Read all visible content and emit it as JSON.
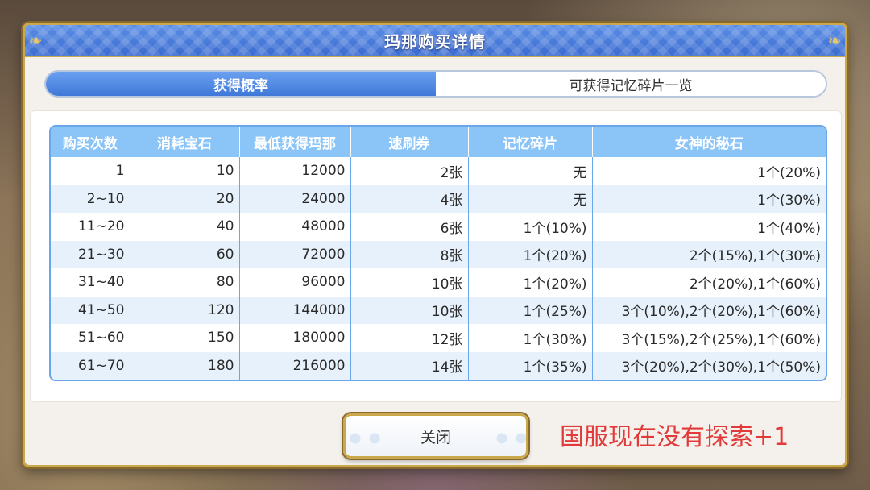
{
  "dialog": {
    "title": "玛那购买详情",
    "tabs": [
      {
        "label": "获得概率",
        "active": true
      },
      {
        "label": "可获得记忆碎片一览",
        "active": false
      }
    ]
  },
  "table": {
    "headers": [
      "购买次数",
      "消耗宝石",
      "最低获得玛那",
      "速刷券",
      "记忆碎片",
      "女神的秘石"
    ],
    "rows": [
      [
        "1",
        "10",
        "12000",
        "2张",
        "无",
        "1个(20%)"
      ],
      [
        "2~10",
        "20",
        "24000",
        "4张",
        "无",
        "1个(30%)"
      ],
      [
        "11~20",
        "40",
        "48000",
        "6张",
        "1个(10%)",
        "1个(40%)"
      ],
      [
        "21~30",
        "60",
        "72000",
        "8张",
        "1个(20%)",
        "2个(15%),1个(30%)"
      ],
      [
        "31~40",
        "80",
        "96000",
        "10张",
        "1个(20%)",
        "2个(20%),1个(60%)"
      ],
      [
        "41~50",
        "120",
        "144000",
        "10张",
        "1个(25%)",
        "3个(10%),2个(20%),1个(60%)"
      ],
      [
        "51~60",
        "150",
        "180000",
        "12张",
        "1个(30%)",
        "3个(15%),2个(25%),1个(60%)"
      ],
      [
        "61~70",
        "180",
        "216000",
        "14张",
        "1个(35%)",
        "3个(20%),2个(30%),1个(50%)"
      ]
    ]
  },
  "footer_note": "",
  "buttons": {
    "close_label": "关闭"
  },
  "overlay": {
    "text": "国服现在没有探索+1",
    "color": "#e23a3a"
  },
  "colors": {
    "title_bar": "#3a6bd0",
    "header_bg": "#8bc4f7",
    "border_gold": "#c9a84e",
    "row_alt": "#e7f1fc"
  }
}
